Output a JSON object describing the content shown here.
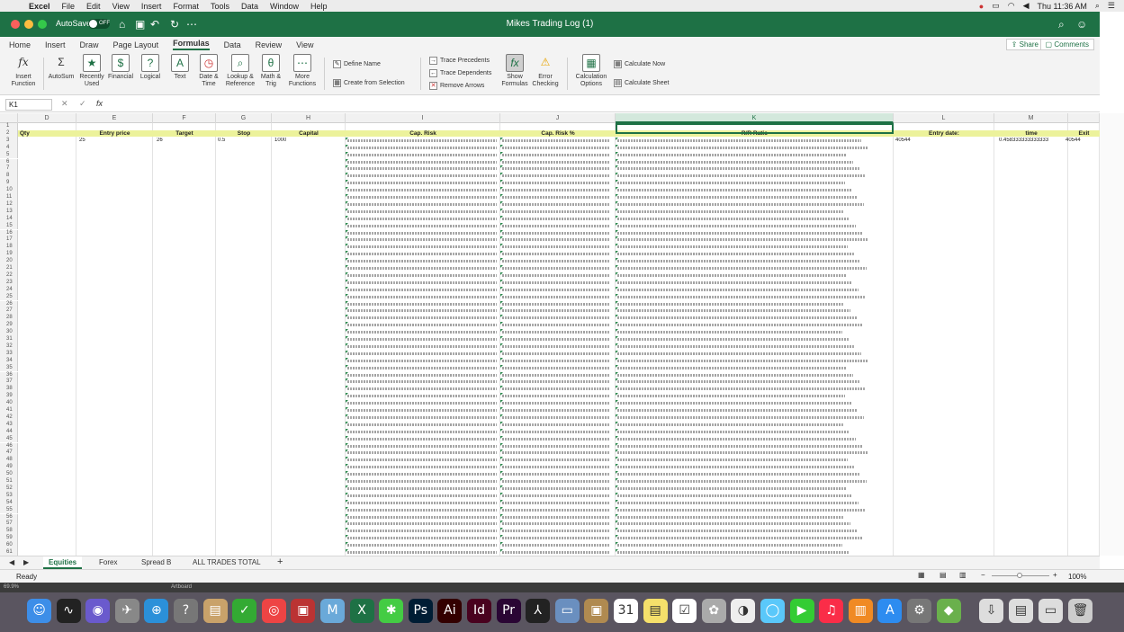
{
  "menubar": {
    "app": "Excel",
    "items": [
      "File",
      "Edit",
      "View",
      "Insert",
      "Format",
      "Tools",
      "Data",
      "Window",
      "Help"
    ],
    "clock": "Thu 11:36 AM"
  },
  "titlebar": {
    "autosave": "AutoSave",
    "toggle": "OFF",
    "title": "Mikes Trading Log  (1)"
  },
  "ribbon_tabs": [
    "Home",
    "Insert",
    "Draw",
    "Page Layout",
    "Formulas",
    "Data",
    "Review",
    "View"
  ],
  "active_tab": "Formulas",
  "share": "Share",
  "comments": "Comments",
  "ribbon": {
    "insert_function": "Insert Function",
    "autosum": "AutoSum",
    "recently_used": "Recently Used",
    "financial": "Financial",
    "logical": "Logical",
    "text": "Text",
    "date_time": "Date & Time",
    "lookup_ref": "Lookup & Reference",
    "math_trig": "Math & Trig",
    "more_functions": "More Functions",
    "define_name": "Define Name",
    "create_from_selection": "Create from Selection",
    "trace_precedents": "Trace Precedents",
    "trace_dependents": "Trace Dependents",
    "remove_arrows": "Remove Arrows",
    "show_formulas": "Show Formulas",
    "error_checking": "Error Checking",
    "calc_options": "Calculation Options",
    "calc_now": "Calculate Now",
    "calc_sheet": "Calculate Sheet"
  },
  "namebox": "K1",
  "columns": [
    "D",
    "E",
    "F",
    "G",
    "H",
    "I",
    "J",
    "K",
    "L",
    "M"
  ],
  "headers": {
    "D": "Qty",
    "E": "Entry price",
    "F": "Target",
    "G": "Stop",
    "H": "Capital",
    "I": "Cap. Risk",
    "J": "Cap. Risk %",
    "K": "R/R Ratio",
    "L": "Entry date:",
    "M": "time",
    "N": "Exit"
  },
  "row3": {
    "E": "25",
    "F": "26",
    "G": "0.5",
    "H": "1000",
    "L": "40544",
    "M": "0.458333333333333",
    "N": "40544"
  },
  "sheet_tabs": [
    "Equities",
    "Forex",
    "Spread B",
    "ALL TRADES TOTAL"
  ],
  "active_sheet": "Equities",
  "status": "Ready",
  "zoom": "100%",
  "bottom_left": "69.9%",
  "artboard": "Artboard"
}
